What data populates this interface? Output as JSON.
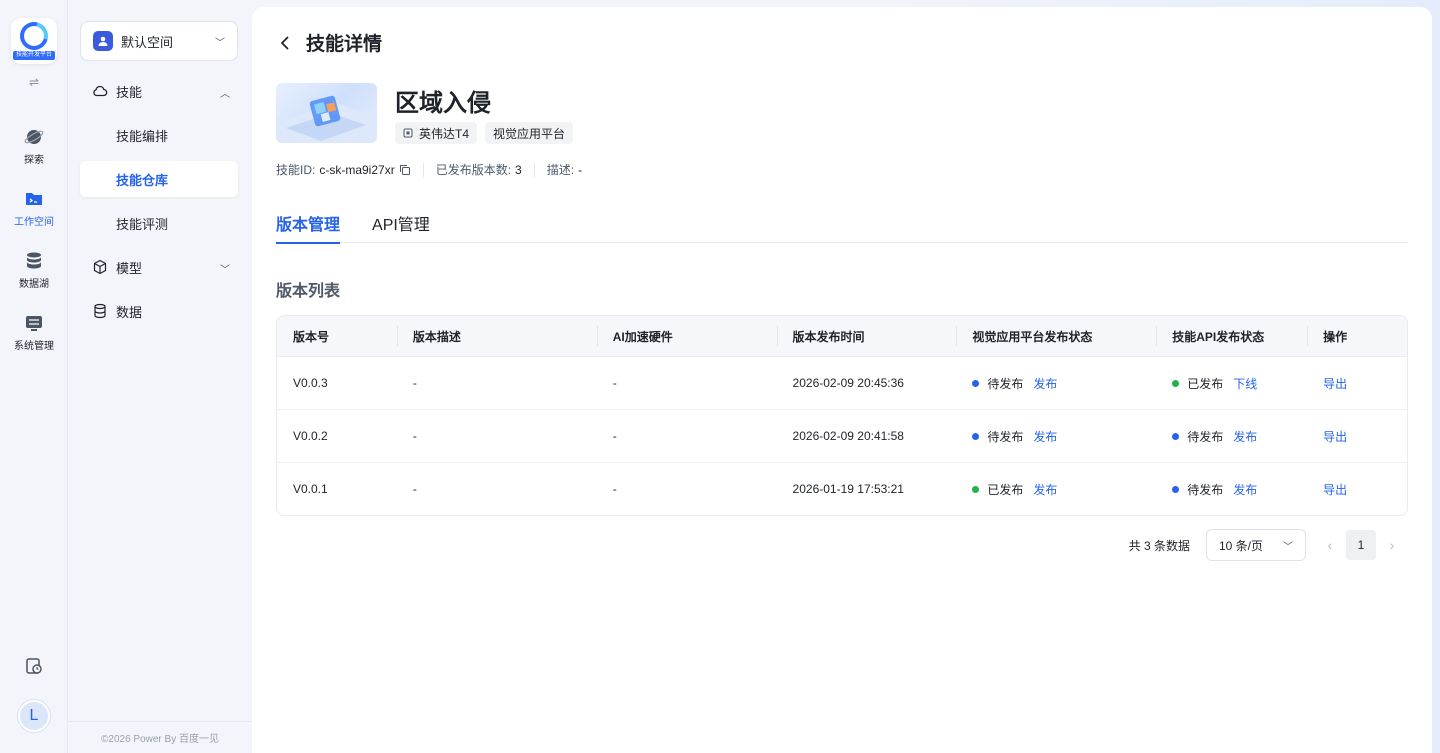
{
  "rail": {
    "logo_caption": "技能开发平台",
    "items": [
      {
        "label": "探索",
        "icon": "planet-icon"
      },
      {
        "label": "工作空间",
        "icon": "workspace-folder-icon",
        "active": true
      },
      {
        "label": "数据湖",
        "icon": "database-icon"
      },
      {
        "label": "系统管理",
        "icon": "system-settings-icon"
      }
    ],
    "avatar_letter": "L"
  },
  "sidebar": {
    "space_label": "默认空间",
    "nav": [
      {
        "label": "技能",
        "icon": "cloud-icon",
        "expanded": true
      },
      {
        "label": "技能编排"
      },
      {
        "label": "技能仓库",
        "active": true
      },
      {
        "label": "技能评测"
      },
      {
        "label": "模型",
        "icon": "cube-icon"
      },
      {
        "label": "数据",
        "icon": "data-stack-icon"
      }
    ],
    "footer": "©2026 Power By 百度一见"
  },
  "header": {
    "title": "技能详情"
  },
  "skill": {
    "name": "区域入侵",
    "tags": [
      "英伟达T4",
      "视觉应用平台"
    ],
    "meta": {
      "id_label": "技能ID:",
      "id_value": "c-sk-ma9i27xr",
      "versions_label": "已发布版本数:",
      "versions_value": "3",
      "desc_label": "描述:",
      "desc_value": "-"
    }
  },
  "tabs": [
    "版本管理",
    "API管理"
  ],
  "section_title": "版本列表",
  "table": {
    "columns": [
      "版本号",
      "版本描述",
      "AI加速硬件",
      "版本发布时间",
      "视觉应用平台发布状态",
      "技能API发布状态",
      "操作"
    ],
    "rows": [
      {
        "version": "V0.0.3",
        "desc": "-",
        "hw": "-",
        "time": "2026-02-09 20:45:36",
        "vis_status": "待发布",
        "vis_dot": "blue",
        "vis_action": "发布",
        "api_status": "已发布",
        "api_dot": "green",
        "api_action": "下线",
        "op": "导出"
      },
      {
        "version": "V0.0.2",
        "desc": "-",
        "hw": "-",
        "time": "2026-02-09 20:41:58",
        "vis_status": "待发布",
        "vis_dot": "blue",
        "vis_action": "发布",
        "api_status": "待发布",
        "api_dot": "blue",
        "api_action": "发布",
        "op": "导出"
      },
      {
        "version": "V0.0.1",
        "desc": "-",
        "hw": "-",
        "time": "2026-01-19 17:53:21",
        "vis_status": "已发布",
        "vis_dot": "green",
        "vis_action": "发布",
        "api_status": "待发布",
        "api_dot": "blue",
        "api_action": "发布",
        "op": "导出"
      }
    ]
  },
  "pagination": {
    "total": "共 3 条数据",
    "page_size": "10 条/页",
    "current_page": "1"
  },
  "colors": {
    "accent": "#2563eb",
    "published": "#22b14c",
    "pending": "#2563eb"
  }
}
